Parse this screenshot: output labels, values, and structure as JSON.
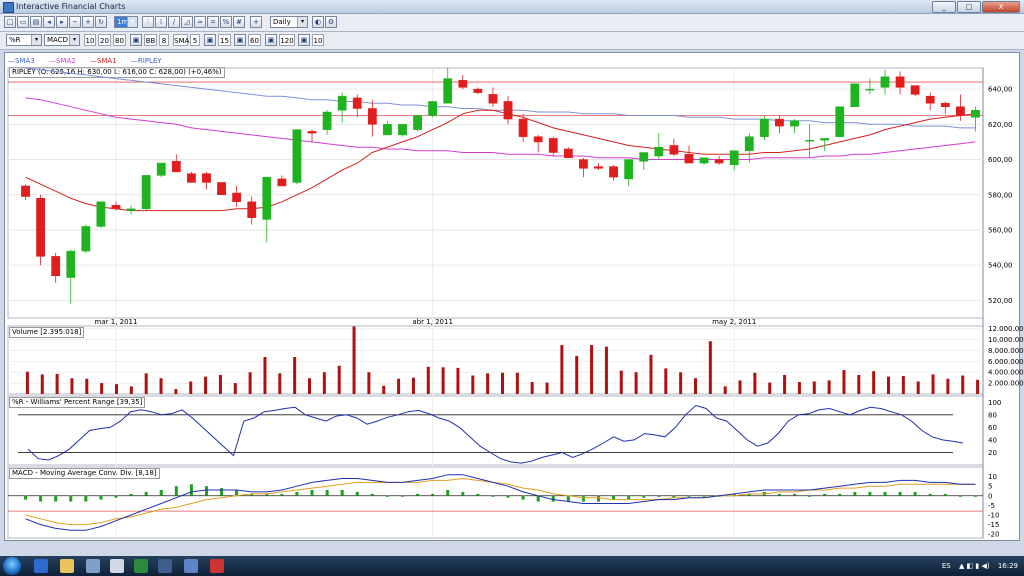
{
  "window": {
    "title": "Interactive Financial Charts",
    "min": "_",
    "max": "□",
    "close": "X"
  },
  "toolbar1": {
    "interval": "1m",
    "period": "Daily"
  },
  "toolbar2": {
    "indicator1": "%R",
    "indicator2": "MACD",
    "params": [
      "10",
      "20",
      "80",
      "BB",
      "8",
      "SMA",
      "5",
      "15",
      "60",
      "120",
      "10"
    ]
  },
  "legend": {
    "items": [
      {
        "label": "SMA3",
        "color": "#3b5fd4"
      },
      {
        "label": "SMA2",
        "color": "#d43bd4"
      },
      {
        "label": "SMA1",
        "color": "#d42020"
      },
      {
        "label": "RIPLEY",
        "color": "#3b5fd4"
      }
    ]
  },
  "price_panel": {
    "label": "RIPLEY (O: 625,16  H: 630,00  L: 616,00  C: 628,00) (+0,46%)"
  },
  "volume_panel": {
    "label": "Volume [2.395.018]"
  },
  "wpr_panel": {
    "label": "%R - Williams' Percent Range [39,35]"
  },
  "macd_panel": {
    "label": "MACD - Moving Average Conv. Div. [8,18]"
  },
  "chart_data": {
    "type": "candlestick",
    "x_labels": [
      {
        "i": 6,
        "label": "mar 1, 2011"
      },
      {
        "i": 27,
        "label": "abr 1, 2011"
      },
      {
        "i": 47,
        "label": "may 2, 2011"
      }
    ],
    "price": {
      "ylim": [
        510,
        652
      ],
      "ticks": [
        520,
        540,
        560,
        580,
        600,
        620,
        640
      ],
      "tick_labels": [
        "520,00",
        "540,00",
        "560,00",
        "580,00",
        "600,00",
        "620,00",
        "640,00"
      ],
      "hlines": [
        644,
        625
      ],
      "candles": [
        [
          585,
          586,
          577,
          579
        ],
        [
          578,
          580,
          540,
          545
        ],
        [
          545,
          547,
          530,
          534
        ],
        [
          533,
          549,
          518,
          548
        ],
        [
          548,
          563,
          547,
          562
        ],
        [
          562,
          576,
          561,
          576
        ],
        [
          574,
          576,
          571,
          572
        ],
        [
          571,
          574,
          569,
          572
        ],
        [
          572,
          591,
          571,
          591
        ],
        [
          591,
          596,
          590,
          598
        ],
        [
          599,
          603,
          593,
          593
        ],
        [
          592,
          593,
          587,
          587
        ],
        [
          592,
          593,
          583,
          587
        ],
        [
          587,
          587,
          580,
          580
        ],
        [
          581,
          585,
          573,
          576
        ],
        [
          576,
          579,
          563,
          567
        ],
        [
          566,
          589,
          553,
          590
        ],
        [
          589,
          591,
          585,
          585
        ],
        [
          587,
          617,
          586,
          617
        ],
        [
          616,
          617,
          610,
          615
        ],
        [
          617,
          628,
          614,
          627
        ],
        [
          628,
          638,
          621,
          636
        ],
        [
          635,
          637,
          624,
          629
        ],
        [
          629,
          634,
          613,
          620
        ],
        [
          614,
          622,
          614,
          620
        ],
        [
          614,
          620,
          613,
          620
        ],
        [
          617,
          625,
          616,
          625
        ],
        [
          625,
          633,
          624,
          633
        ],
        [
          632,
          652,
          632,
          646
        ],
        [
          645,
          648,
          640,
          641
        ],
        [
          640,
          641,
          637,
          638
        ],
        [
          637,
          641,
          630,
          632
        ],
        [
          633,
          636,
          620,
          623
        ],
        [
          623,
          626,
          610,
          613
        ],
        [
          613,
          614,
          604,
          610
        ],
        [
          612,
          613,
          602,
          604
        ],
        [
          606,
          607,
          601,
          601
        ],
        [
          600,
          601,
          590,
          595
        ],
        [
          596,
          598,
          594,
          595
        ],
        [
          596,
          597,
          588,
          590
        ],
        [
          589,
          596,
          585,
          600
        ],
        [
          599,
          600,
          594,
          604
        ],
        [
          602,
          615,
          600,
          607
        ],
        [
          608,
          612,
          602,
          603
        ],
        [
          603,
          608,
          599,
          598
        ],
        [
          598,
          601,
          597,
          601
        ],
        [
          600,
          602,
          597,
          598
        ],
        [
          597,
          598,
          594,
          605
        ],
        [
          605,
          615,
          598,
          613
        ],
        [
          613,
          625,
          611,
          623
        ],
        [
          623,
          625,
          615,
          619
        ],
        [
          619,
          623,
          615,
          622
        ],
        [
          611,
          620,
          601,
          611
        ],
        [
          611,
          612,
          605,
          612
        ],
        [
          613,
          630,
          613,
          630
        ],
        [
          630,
          640,
          630,
          643
        ],
        [
          640,
          646,
          637,
          640
        ],
        [
          641,
          651,
          637,
          647
        ],
        [
          647,
          650,
          637,
          641
        ],
        [
          642,
          642,
          636,
          637
        ],
        [
          636,
          638,
          628,
          632
        ],
        [
          632,
          633,
          626,
          630
        ],
        [
          630,
          637,
          622,
          625
        ],
        [
          624,
          630,
          616,
          628
        ]
      ],
      "sma_blue": [
        652,
        651,
        650,
        649,
        648,
        647,
        646,
        645,
        644,
        643,
        642,
        641,
        640,
        639,
        638,
        637,
        636,
        636,
        635,
        634,
        634,
        633,
        633,
        632,
        632,
        631,
        631,
        630,
        630,
        629,
        629,
        628,
        628,
        628,
        627,
        627,
        627,
        626,
        626,
        626,
        625,
        625,
        625,
        625,
        624,
        624,
        624,
        623,
        623,
        623,
        622,
        622,
        622,
        621,
        621,
        621,
        620,
        620,
        620,
        619,
        619,
        619,
        618,
        618
      ],
      "sma_magenta": [
        635,
        634,
        632,
        630,
        628,
        626,
        624,
        623,
        622,
        621,
        620,
        618,
        617,
        616,
        615,
        614,
        613,
        612,
        611,
        610,
        609,
        608,
        607,
        607,
        606,
        606,
        605,
        605,
        605,
        604,
        604,
        604,
        603,
        603,
        603,
        602,
        602,
        602,
        601,
        601,
        601,
        600,
        600,
        600,
        600,
        600,
        600,
        600,
        600,
        601,
        601,
        601,
        601,
        602,
        602,
        603,
        603,
        604,
        605,
        606,
        607,
        608,
        609,
        610
      ],
      "sma_red": [
        590,
        586,
        582,
        578,
        575,
        573,
        572,
        571,
        571,
        571,
        571,
        571,
        571,
        571,
        572,
        572,
        573,
        576,
        580,
        584,
        589,
        594,
        598,
        604,
        607,
        610,
        613,
        617,
        621,
        626,
        628,
        628,
        626,
        624,
        621,
        618,
        616,
        614,
        612,
        610,
        608,
        607,
        606,
        605,
        604,
        603,
        603,
        603,
        603,
        604,
        604,
        605,
        606,
        608,
        610,
        612,
        614,
        617,
        619,
        621,
        623,
        624,
        625,
        626
      ]
    },
    "volume": {
      "ylim": [
        0,
        12500000
      ],
      "ticks": [
        2000000,
        4000000,
        6000000,
        8000000,
        10000000,
        12000000
      ],
      "tick_labels": [
        "2.000.000",
        "4.000.000",
        "6.000.000",
        "8.000.000",
        "10.000.000",
        "12.000.000"
      ],
      "values": [
        4100000,
        3600000,
        3700000,
        2900000,
        2800000,
        2000000,
        1800000,
        1400000,
        3800000,
        2900000,
        900000,
        2300000,
        3200000,
        3500000,
        2000000,
        4000000,
        6800000,
        3800000,
        6800000,
        2900000,
        4000000,
        5200000,
        12400000,
        4000000,
        1500000,
        2800000,
        3000000,
        5000000,
        4900000,
        4800000,
        3400000,
        3800000,
        3900000,
        3900000,
        2200000,
        2100000,
        9000000,
        7000000,
        9000000,
        8700000,
        4300000,
        4000000,
        7200000,
        4700000,
        4000000,
        2900000,
        9700000,
        1400000,
        2500000,
        3900000,
        2100000,
        3500000,
        2200000,
        2300000,
        2500000,
        4400000,
        3500000,
        4200000,
        3200000,
        3300000,
        2300000,
        3600000,
        2800000,
        3400000,
        2600000
      ]
    },
    "wpr": {
      "ylim": [
        0,
        110
      ],
      "ticks": [
        20,
        40,
        60,
        80,
        100
      ],
      "tick_labels": [
        "20",
        "40",
        "60",
        "80",
        "100"
      ],
      "hlines": [
        80,
        20
      ],
      "values": [
        25,
        10,
        8,
        15,
        25,
        40,
        55,
        58,
        60,
        70,
        85,
        88,
        85,
        80,
        82,
        88,
        75,
        60,
        45,
        30,
        15,
        70,
        75,
        85,
        87,
        90,
        92,
        80,
        75,
        70,
        78,
        80,
        75,
        65,
        70,
        76,
        80,
        85,
        87,
        82,
        75,
        70,
        60,
        45,
        30,
        20,
        10,
        5,
        3,
        6,
        12,
        16,
        20,
        12,
        18,
        26,
        35,
        45,
        38,
        40,
        50,
        48,
        45,
        60,
        80,
        95,
        90,
        75,
        70,
        55,
        40,
        30,
        35,
        50,
        70,
        80,
        82,
        88,
        90,
        85,
        80,
        87,
        92,
        90,
        85,
        80,
        70,
        55,
        45,
        40,
        38,
        35
      ]
    },
    "macd": {
      "ylim": [
        -22,
        15
      ],
      "ticks": [
        10,
        5,
        0,
        -5,
        -10,
        -15,
        -20
      ],
      "tick_labels": [
        "10",
        "5",
        "0",
        "-5",
        "-10",
        "-15",
        "-20"
      ],
      "hlines": [
        0,
        -8
      ],
      "macd": [
        -12,
        -15,
        -17,
        -18,
        -18,
        -16,
        -13,
        -10,
        -7,
        -4,
        -1,
        2,
        3,
        3,
        3,
        2,
        2,
        3,
        5,
        7,
        8,
        9,
        9,
        8,
        7,
        7,
        8,
        9,
        11,
        11,
        9,
        7,
        5,
        2,
        0,
        -2,
        -3,
        -4,
        -4,
        -4,
        -4,
        -3,
        -2,
        -2,
        -1,
        -1,
        0,
        1,
        2,
        3,
        3,
        3,
        3,
        4,
        5,
        6,
        7,
        7,
        8,
        8,
        7,
        7,
        6,
        6
      ],
      "signal": [
        -10,
        -12,
        -14,
        -15,
        -15,
        -14,
        -12,
        -11,
        -9,
        -7,
        -6,
        -4,
        -2,
        -1,
        0,
        1,
        1,
        2,
        3,
        4,
        5,
        6,
        7,
        7,
        7,
        7,
        7,
        8,
        8,
        9,
        8,
        7,
        6,
        4,
        3,
        1,
        0,
        -1,
        -1,
        -2,
        -2,
        -2,
        -2,
        -1,
        -1,
        -1,
        0,
        0,
        1,
        1,
        2,
        2,
        3,
        3,
        4,
        4,
        5,
        5,
        6,
        6,
        6,
        6,
        6,
        6
      ],
      "histogram": [
        -2,
        -3,
        -3,
        -3,
        -3,
        -2,
        -1,
        1,
        2,
        3,
        5,
        6,
        5,
        4,
        3,
        1,
        1,
        1,
        2,
        3,
        3,
        3,
        2,
        1,
        0,
        0,
        1,
        1,
        3,
        2,
        1,
        0,
        -1,
        -2,
        -3,
        -3,
        -3,
        -3,
        -3,
        -2,
        -2,
        -1,
        0,
        -1,
        0,
        0,
        0,
        1,
        1,
        2,
        1,
        1,
        0,
        1,
        1,
        2,
        2,
        2,
        2,
        2,
        1,
        1,
        0,
        0
      ]
    }
  },
  "taskbar": {
    "lang": "ES",
    "time": "16:29"
  }
}
